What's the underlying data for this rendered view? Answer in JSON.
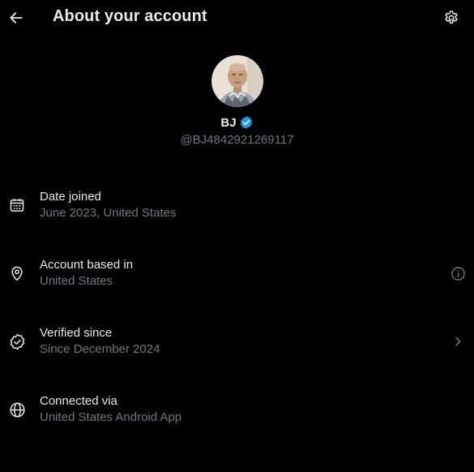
{
  "header": {
    "title": "About your account",
    "back_icon": "arrow-left-icon",
    "settings_icon": "gear-icon"
  },
  "profile": {
    "display_name": "BJ",
    "handle": "@BJ4842921269117",
    "verified": true,
    "verified_color": "#1d9bf0"
  },
  "items": [
    {
      "label": "Date joined",
      "value": "June 2023, United States",
      "icon": "calendar-icon"
    },
    {
      "label": "Account based in",
      "value": "United States",
      "icon": "location-pin-icon",
      "trailing_icon": "info-icon"
    },
    {
      "label": "Verified since",
      "value": "Since December 2024",
      "icon": "verified-badge-icon",
      "trailing_icon": "chevron-right-icon"
    },
    {
      "label": "Connected via",
      "value": "United States Android App",
      "icon": "globe-icon"
    }
  ],
  "colors": {
    "background": "#000000",
    "primary_text": "#e7e9ea",
    "secondary_text": "#71767b",
    "accent": "#1d9bf0"
  }
}
